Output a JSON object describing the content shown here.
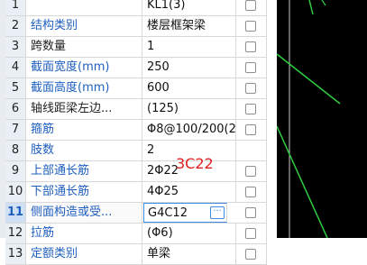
{
  "rows": [
    {
      "num": "1",
      "name": "",
      "value": "KL1(3)",
      "checkbox": true,
      "name_blue": false
    },
    {
      "num": "2",
      "name": "结构类别",
      "value": "楼层框架梁",
      "checkbox": true,
      "name_blue": true
    },
    {
      "num": "3",
      "name": "跨数量",
      "value": "1",
      "checkbox": true,
      "name_blue": false
    },
    {
      "num": "4",
      "name": "截面宽度(mm)",
      "value": "250",
      "checkbox": true,
      "name_blue": true
    },
    {
      "num": "5",
      "name": "截面高度(mm)",
      "value": "600",
      "checkbox": true,
      "name_blue": true
    },
    {
      "num": "6",
      "name": "轴线距梁左边...",
      "value": "(125)",
      "checkbox": true,
      "name_blue": false
    },
    {
      "num": "7",
      "name": "箍筋",
      "value": "Φ8@100/200(2)",
      "checkbox": true,
      "name_blue": true
    },
    {
      "num": "8",
      "name": "肢数",
      "value": "2",
      "checkbox": false,
      "name_blue": true
    },
    {
      "num": "9",
      "name": "上部通长筋",
      "value": "2Φ22",
      "checkbox": true,
      "name_blue": true
    },
    {
      "num": "10",
      "name": "下部通长筋",
      "value": "4Φ25",
      "checkbox": true,
      "name_blue": true
    },
    {
      "num": "11",
      "name": "侧面构造或受...",
      "value": "G4C12",
      "checkbox": true,
      "name_blue": true
    },
    {
      "num": "12",
      "name": "拉筋",
      "value": "(Φ6)",
      "checkbox": true,
      "name_blue": true
    },
    {
      "num": "13",
      "name": "定额类别",
      "value": "单梁",
      "checkbox": true,
      "name_blue": true
    }
  ],
  "active_row": "11",
  "edit_button_label": "···",
  "annotation": "3C22",
  "colors": {
    "label_blue": "#1f5fbf",
    "annotation_red": "#e02020",
    "canvas_line": "#2ecc40"
  }
}
